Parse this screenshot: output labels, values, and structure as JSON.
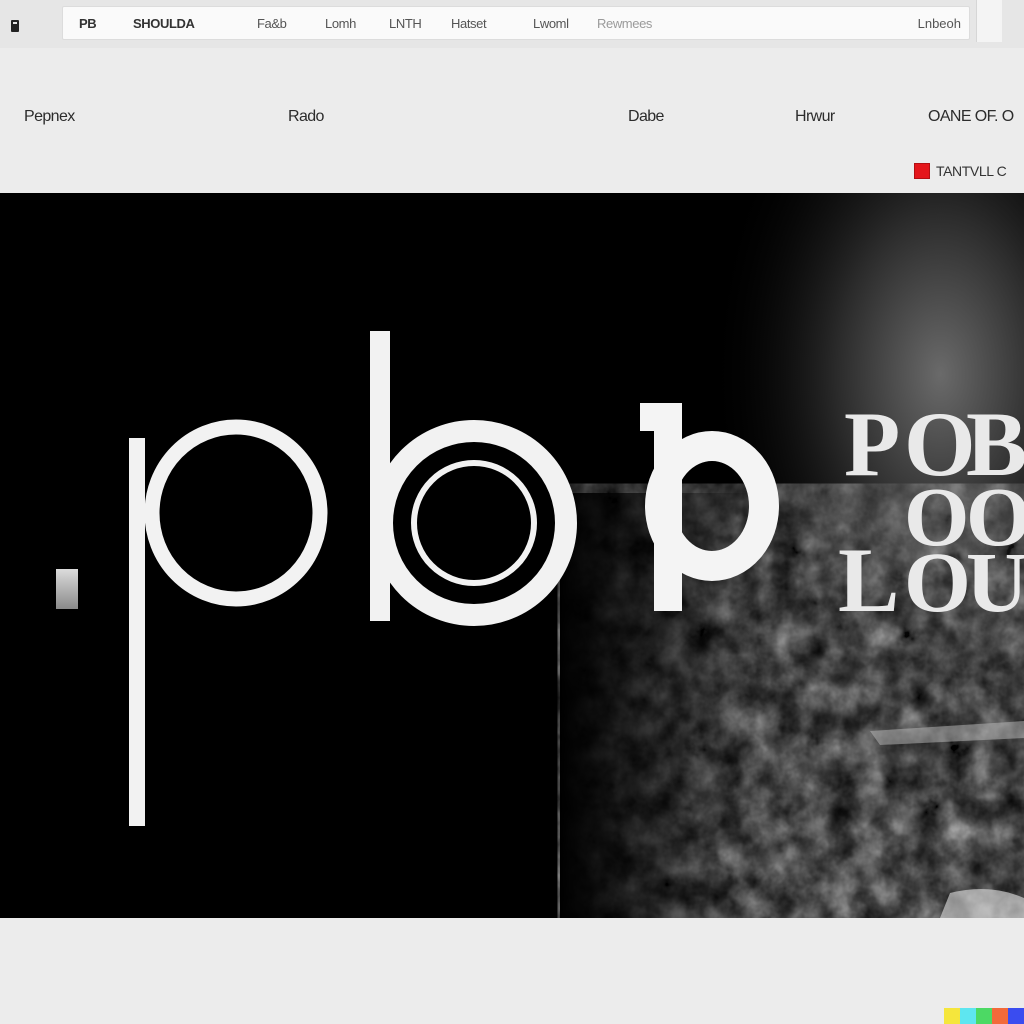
{
  "chrome": {
    "links": [
      {
        "label": "PB",
        "style": "strong"
      },
      {
        "label": "SHOULDA",
        "style": "strong"
      },
      {
        "label": "Fa&b",
        "style": "normal"
      },
      {
        "label": "Lomh",
        "style": "normal"
      },
      {
        "label": "LNTH",
        "style": "normal"
      },
      {
        "label": "Hatset",
        "style": "normal"
      },
      {
        "label": "Lwoml",
        "style": "normal"
      },
      {
        "label": "Rewmees",
        "style": "faint"
      }
    ],
    "sign_label": "Lnbeoh"
  },
  "header": {
    "nav": [
      "Pepnex",
      "Rado",
      "Dabe",
      "Hrwur",
      "OANE OF. O"
    ],
    "utility_label": "TANTVLL C"
  },
  "hero": {
    "logo_left": ".pb",
    "logo_right_glyph": "b",
    "stack_letters": [
      "P",
      "O",
      "B",
      "O",
      "O",
      "L",
      "O",
      "U"
    ]
  },
  "footer": {
    "color_bar": [
      "#f5e63c",
      "#5ee6f0",
      "#4cd964",
      "#f26a3a",
      "#3a4cf0"
    ]
  }
}
